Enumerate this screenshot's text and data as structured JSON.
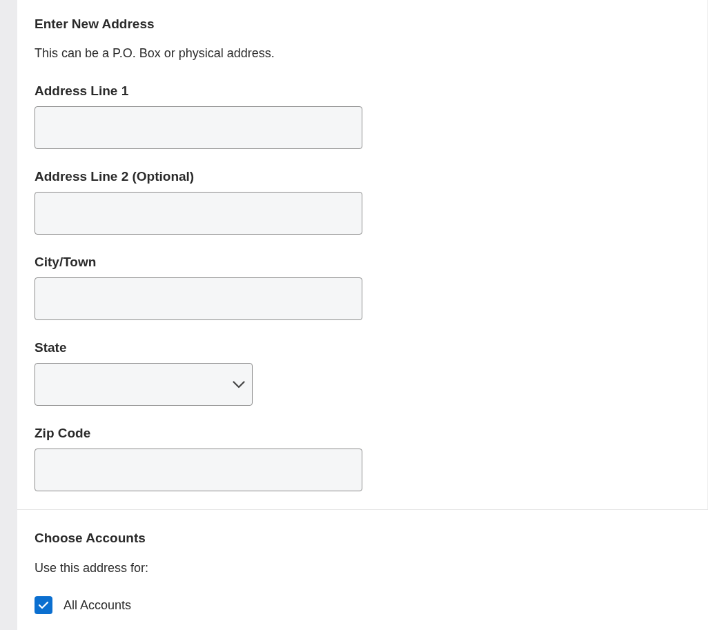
{
  "address_section": {
    "title": "Enter New Address",
    "description": "This can be a P.O. Box or physical address.",
    "fields": [
      {
        "kind": "text",
        "label": "Address Line 1"
      },
      {
        "kind": "text",
        "label": "Address Line 2 (Optional)"
      },
      {
        "kind": "text",
        "label": "City/Town"
      },
      {
        "kind": "select",
        "label": "State"
      },
      {
        "kind": "text",
        "label": "Zip Code"
      }
    ]
  },
  "accounts_section": {
    "title": "Choose Accounts",
    "description": "Use this address for:",
    "options": [
      {
        "label": "All Accounts",
        "checked": true
      }
    ]
  }
}
